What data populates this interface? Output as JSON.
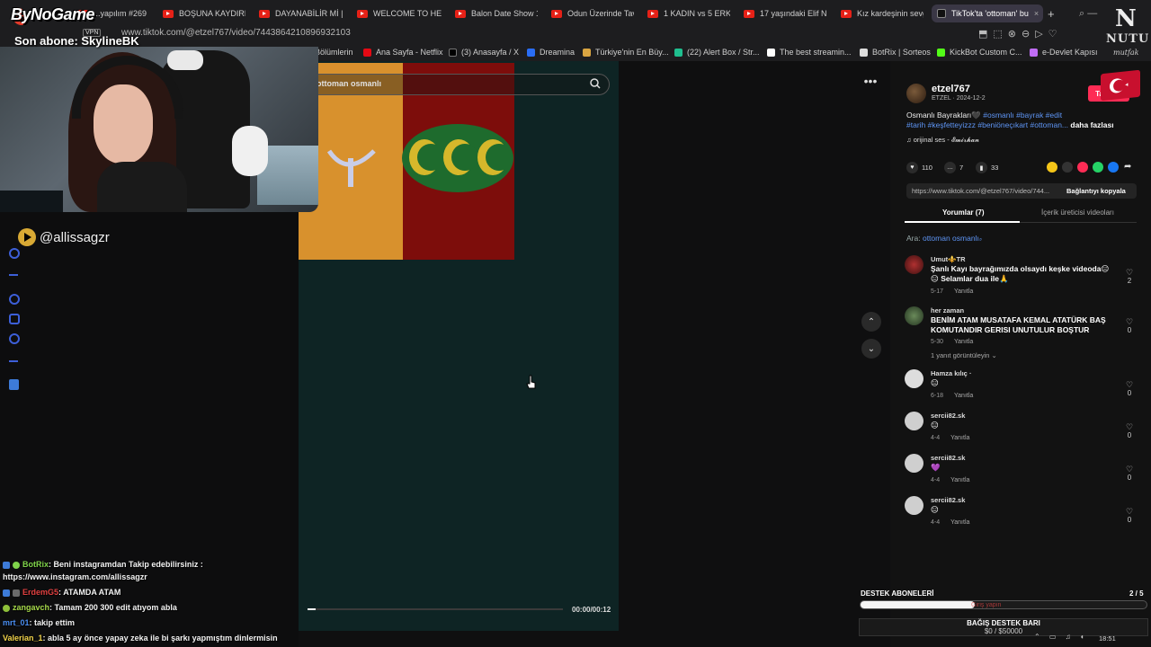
{
  "browser": {
    "tabs": [
      {
        "label": "...yapılım #269"
      },
      {
        "label": "BOŞUNA KAYDIRMA"
      },
      {
        "label": "DAYANABİLİR Mİ | N"
      },
      {
        "label": "WELCOME TO HELL"
      },
      {
        "label": "Balon Date Show 17"
      },
      {
        "label": "Odun Üzerinde Tavu"
      },
      {
        "label": "1 KADIN vs 5 ERKEK"
      },
      {
        "label": "17 yaşındaki Elif Nu"
      },
      {
        "label": "Kız kardeşinin sevgi"
      },
      {
        "label": "TikTok'ta 'ottoman' bu"
      }
    ],
    "vpn_label": "VPN",
    "url": "www.tiktok.com/@etzel767/video/7443864210896932103",
    "bookmarks": [
      {
        "label": "Bölümlerin"
      },
      {
        "label": "Ana Sayfa - Netflix"
      },
      {
        "label": "(3) Anasayfa / X"
      },
      {
        "label": "Dreamina"
      },
      {
        "label": "Türkiye'nin En Büy..."
      },
      {
        "label": "(22) Alert Box / Str..."
      },
      {
        "label": "The best streamin..."
      },
      {
        "label": "BotRix | Sorteos"
      },
      {
        "label": "KickBot Custom C..."
      },
      {
        "label": "e-Devlet Kapısı"
      }
    ]
  },
  "stream_overlay": {
    "logo_text": "ByNoGame",
    "last_subscriber": "Son abone: SkylineBK",
    "handle": "@allissagzr",
    "corner_logo": {
      "letter": "N",
      "word": "NUTU",
      "script": "mutfak"
    }
  },
  "tiktok": {
    "search_value": "ottoman osmanlı",
    "video": {
      "time": "00:00/00:12",
      "progress": 0.03
    },
    "author": {
      "name": "etzel767",
      "meta": "ETZEL · 2024-12-2"
    },
    "follow_label": "Takip et",
    "caption": {
      "text": "Osmanlı Bayrakları🖤",
      "tags_line1": "#osmanlı #bayrak #edit",
      "tags_line2": "#tarih #keşfetteyizzz #beniöneçıkart #ottoman...",
      "more": "daha fazlası"
    },
    "sound": "orijinal ses - 𝓔𝓶𝓲𝓻𝓱𝓪𝓷",
    "stats": {
      "likes": "110",
      "comments": "7",
      "saves": "33"
    },
    "link": "https://www.tiktok.com/@etzel767/video/744...",
    "copy_link_label": "Bağlantıyı kopyala",
    "tabs": {
      "comments": "Yorumlar (7)",
      "creator": "İçerik üreticisi videoları"
    },
    "search_hint": {
      "prefix": "Ara:",
      "query": "ottoman osmanlı"
    },
    "comments": [
      {
        "user": "Umut⚜️TR",
        "text": "Şanlı Kayı bayrağımızda olsaydı keşke videoda😑 😑 Selamlar dua ile🙏",
        "date": "5-17",
        "reply": "Yanıtla",
        "likes": "2"
      },
      {
        "user": "her zaman",
        "text": "BENİM ATAM MUSATAFA KEMAL ATATÜRK BAŞ KOMUTANDIR GERISI UNUTULUR BOŞTUR",
        "date": "5-30",
        "reply": "Yanıtla",
        "likes": "0",
        "more": "1 yanıt görüntüleyin"
      },
      {
        "user": "Hamza kılıç ·",
        "text": "😑",
        "date": "6-18",
        "reply": "Yanıtla",
        "likes": "0"
      },
      {
        "user": "sercii82.sk",
        "text": "😑",
        "date": "4-4",
        "reply": "Yanıtla",
        "likes": "0"
      },
      {
        "user": "sercii82.sk",
        "text": "💜",
        "date": "4-4",
        "reply": "Yanıtla",
        "likes": "0"
      },
      {
        "user": "sercii82.sk",
        "text": "😑",
        "date": "4-4",
        "reply": "Yanıtla",
        "likes": "0"
      }
    ]
  },
  "chat": [
    {
      "user": "BotRix",
      "msg": ": Beni instagramdan Takip edebilirsiniz :",
      "color": "#7fd34a"
    },
    {
      "user": "",
      "msg": "https://www.instagram.com/allissagzr",
      "color": "#ffffff"
    },
    {
      "user": "ErdemG5",
      "msg": ": ATAMDA ATAM",
      "color": "#e04040"
    },
    {
      "user": "zangavch",
      "msg": ": Tamam 200 300 edit atıyom abla",
      "color": "#a6d84a"
    },
    {
      "user": "mrt_01",
      "msg": ": takip ettim",
      "color": "#4a8df0"
    },
    {
      "user": "Valerian_1",
      "msg": ": abla 5 ay önce yapay zeka ile bi şarkı yapmıştım dinlermisin",
      "color": "#f0d24a"
    }
  ],
  "donation": {
    "title": "DESTEK ABONELERİ",
    "count": "2 / 5",
    "progress": 0.4,
    "ghost_text": "Giriş yapın",
    "bar_label": "BAĞIŞ DESTEK BARI",
    "amount": "$0 / $50000"
  },
  "system": {
    "clock": "18:51"
  }
}
